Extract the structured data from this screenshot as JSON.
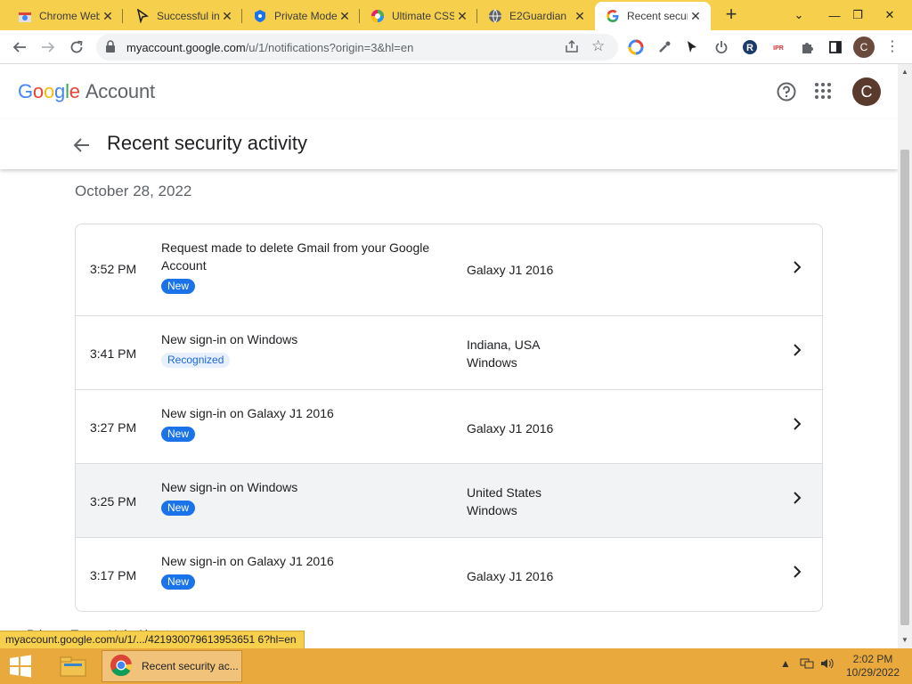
{
  "browser": {
    "tabs": [
      {
        "title": "Chrome Web Store",
        "icon": "chrome-store-icon"
      },
      {
        "title": "Successful in",
        "icon": "cursor-arrow-icon"
      },
      {
        "title": "Private Mode",
        "icon": "private-mode-icon"
      },
      {
        "title": "Ultimate CSS",
        "icon": "color-wheel-icon"
      },
      {
        "title": "E2Guardian",
        "icon": "globe-icon"
      },
      {
        "title": "Recent security activity",
        "icon": "google-g-icon"
      }
    ],
    "url_main": "myaccount.google.com",
    "url_path": "/u/1/notifications?origin=3&hl=en",
    "profile_initial": "C"
  },
  "header": {
    "logo": "Google",
    "product": "Account",
    "avatar_initial": "C"
  },
  "page_title": "Recent security activity",
  "date_heading": "October 28, 2022",
  "events": [
    {
      "time": "3:52 PM",
      "description": "Request made to delete Gmail from your Google Account",
      "badge": "New",
      "location": "Galaxy J1 2016"
    },
    {
      "time": "3:41 PM",
      "description": "New sign-in on Windows",
      "badge": "Recognized",
      "location": "Indiana, USA\nWindows"
    },
    {
      "time": "3:27 PM",
      "description": "New sign-in on Galaxy J1 2016",
      "badge": "New",
      "location": "Galaxy J1 2016"
    },
    {
      "time": "3:25 PM",
      "description": "New sign-in on Windows",
      "badge": "New",
      "location": "United States\nWindows"
    },
    {
      "time": "3:17 PM",
      "description": "New sign-in on Galaxy J1 2016",
      "badge": "New",
      "location": "Galaxy J1 2016"
    }
  ],
  "footer_partial": "Privacy Terms Help About",
  "status_url": "myaccount.google.com/u/1/.../421930079613953651 6?hl=en",
  "taskbar": {
    "chrome_label": "Recent security ac...",
    "time": "2:02 PM",
    "date": "10/29/2022"
  },
  "colors": {
    "chrome_frame": "#f6d04d",
    "taskbar": "#e9a93c",
    "badge_new": "#1a73e8",
    "badge_recognized_bg": "#e8f0fe"
  }
}
